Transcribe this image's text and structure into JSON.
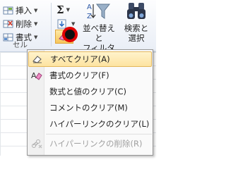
{
  "ribbon": {
    "insert_label": "挿入",
    "delete_label": "削除",
    "format_label": "書式",
    "cells_group_label": "セル",
    "sigma_glyph": "Σ",
    "sort_filter_label_1": "並べ替えと",
    "sort_filter_label_2": "フィルター",
    "find_select_label_1": "検索と",
    "find_select_label_2": "選択"
  },
  "menu": {
    "items": [
      {
        "label": "すべてクリア(A)",
        "icon": "eraser-icon",
        "highlighted": true,
        "enabled": true
      },
      {
        "label": "書式のクリア(F)",
        "icon": "clear-formats-icon",
        "highlighted": false,
        "enabled": true
      },
      {
        "label": "数式と値のクリア(C)",
        "icon": "",
        "highlighted": false,
        "enabled": true
      },
      {
        "label": "コメントのクリア(M)",
        "icon": "",
        "highlighted": false,
        "enabled": true
      },
      {
        "label": "ハイパーリンクのクリア(L)",
        "icon": "",
        "highlighted": false,
        "enabled": true
      },
      {
        "label": "ハイパーリンクの削除(R)",
        "icon": "remove-hyperlink-icon",
        "highlighted": false,
        "enabled": false
      }
    ]
  },
  "colors": {
    "highlight": "#fde3a0",
    "annotation_ring": "#e00000"
  }
}
